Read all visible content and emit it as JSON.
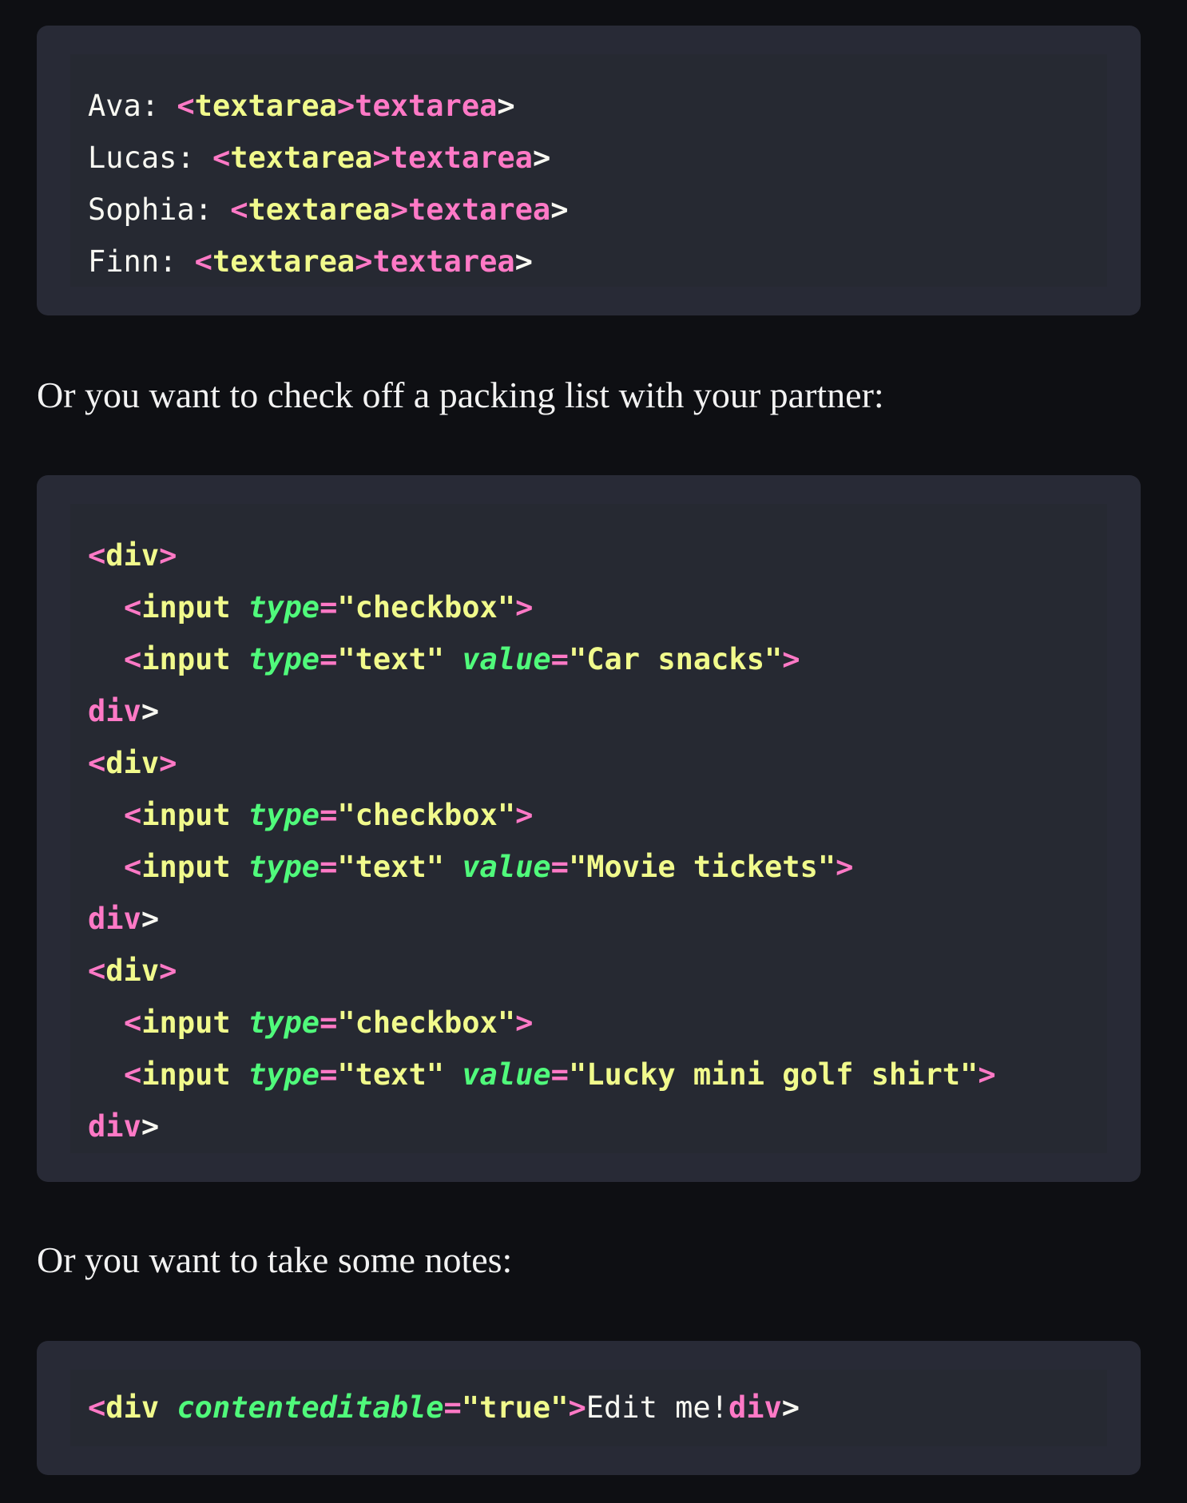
{
  "block1": {
    "lines": [
      {
        "label": "Ava: ",
        "open_lt": "<",
        "open_tag": "textarea",
        "open_gt": ">",
        "close_tag": "textarea",
        "close_gt": ">"
      },
      {
        "label": "Lucas: ",
        "open_lt": "<",
        "open_tag": "textarea",
        "open_gt": ">",
        "close_tag": "textarea",
        "close_gt": ">"
      },
      {
        "label": "Sophia: ",
        "open_lt": "<",
        "open_tag": "textarea",
        "open_gt": ">",
        "close_tag": "textarea",
        "close_gt": ">"
      },
      {
        "label": "Finn: ",
        "open_lt": "<",
        "open_tag": "textarea",
        "open_gt": ">",
        "close_tag": "textarea",
        "close_gt": ">"
      }
    ]
  },
  "paragraph1": "Or you want to check off a packing list with your partner:",
  "block2": {
    "groups": [
      {
        "open": {
          "lt": "<",
          "tag": "div",
          "gt": ">"
        },
        "checkbox": {
          "lt": "<",
          "tag": "input",
          "attr": "type",
          "eq": "=",
          "val": "\"checkbox\"",
          "gt": ">"
        },
        "text": {
          "lt": "<",
          "tag": "input",
          "attr1": "type",
          "eq1": "=",
          "val1": "\"text\"",
          "attr2": "value",
          "eq2": "=",
          "val2": "\"Car snacks\"",
          "gt": ">"
        },
        "close": {
          "tag": "div",
          "gt": ">"
        }
      },
      {
        "open": {
          "lt": "<",
          "tag": "div",
          "gt": ">"
        },
        "checkbox": {
          "lt": "<",
          "tag": "input",
          "attr": "type",
          "eq": "=",
          "val": "\"checkbox\"",
          "gt": ">"
        },
        "text": {
          "lt": "<",
          "tag": "input",
          "attr1": "type",
          "eq1": "=",
          "val1": "\"text\"",
          "attr2": "value",
          "eq2": "=",
          "val2": "\"Movie tickets\"",
          "gt": ">"
        },
        "close": {
          "tag": "div",
          "gt": ">"
        }
      },
      {
        "open": {
          "lt": "<",
          "tag": "div",
          "gt": ">"
        },
        "checkbox": {
          "lt": "<",
          "tag": "input",
          "attr": "type",
          "eq": "=",
          "val": "\"checkbox\"",
          "gt": ">"
        },
        "text": {
          "lt": "<",
          "tag": "input",
          "attr1": "type",
          "eq1": "=",
          "val1": "\"text\"",
          "attr2": "value",
          "eq2": "=",
          "val2": "\"Lucky mini golf shirt\"",
          "gt": ">"
        },
        "close": {
          "tag": "div",
          "gt": ">"
        }
      }
    ]
  },
  "paragraph2": "Or you want to take some notes:",
  "block3": {
    "lt": "<",
    "tag": "div",
    "attr": "contenteditable",
    "eq": "=",
    "val": "\"true\"",
    "gt": ">",
    "content": "Edit me!",
    "close_tag": "div",
    "close_gt": ">"
  },
  "colors": {
    "page_bg": "#0e0f13",
    "code_bg": "#282a36",
    "tag_pink": "#ff79c6",
    "string_yellow": "#f1fa8c",
    "attr_green": "#50fa7b",
    "text_white": "#f8f8f2"
  }
}
